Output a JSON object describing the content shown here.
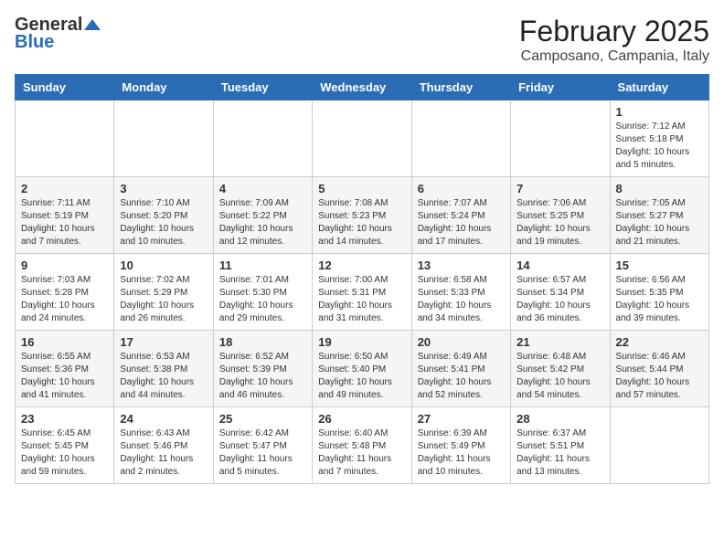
{
  "header": {
    "logo_general": "General",
    "logo_blue": "Blue",
    "month_title": "February 2025",
    "location": "Camposano, Campania, Italy"
  },
  "days_of_week": [
    "Sunday",
    "Monday",
    "Tuesday",
    "Wednesday",
    "Thursday",
    "Friday",
    "Saturday"
  ],
  "weeks": [
    [
      {
        "day": "",
        "info": ""
      },
      {
        "day": "",
        "info": ""
      },
      {
        "day": "",
        "info": ""
      },
      {
        "day": "",
        "info": ""
      },
      {
        "day": "",
        "info": ""
      },
      {
        "day": "",
        "info": ""
      },
      {
        "day": "1",
        "info": "Sunrise: 7:12 AM\nSunset: 5:18 PM\nDaylight: 10 hours and 5 minutes."
      }
    ],
    [
      {
        "day": "2",
        "info": "Sunrise: 7:11 AM\nSunset: 5:19 PM\nDaylight: 10 hours and 7 minutes."
      },
      {
        "day": "3",
        "info": "Sunrise: 7:10 AM\nSunset: 5:20 PM\nDaylight: 10 hours and 10 minutes."
      },
      {
        "day": "4",
        "info": "Sunrise: 7:09 AM\nSunset: 5:22 PM\nDaylight: 10 hours and 12 minutes."
      },
      {
        "day": "5",
        "info": "Sunrise: 7:08 AM\nSunset: 5:23 PM\nDaylight: 10 hours and 14 minutes."
      },
      {
        "day": "6",
        "info": "Sunrise: 7:07 AM\nSunset: 5:24 PM\nDaylight: 10 hours and 17 minutes."
      },
      {
        "day": "7",
        "info": "Sunrise: 7:06 AM\nSunset: 5:25 PM\nDaylight: 10 hours and 19 minutes."
      },
      {
        "day": "8",
        "info": "Sunrise: 7:05 AM\nSunset: 5:27 PM\nDaylight: 10 hours and 21 minutes."
      }
    ],
    [
      {
        "day": "9",
        "info": "Sunrise: 7:03 AM\nSunset: 5:28 PM\nDaylight: 10 hours and 24 minutes."
      },
      {
        "day": "10",
        "info": "Sunrise: 7:02 AM\nSunset: 5:29 PM\nDaylight: 10 hours and 26 minutes."
      },
      {
        "day": "11",
        "info": "Sunrise: 7:01 AM\nSunset: 5:30 PM\nDaylight: 10 hours and 29 minutes."
      },
      {
        "day": "12",
        "info": "Sunrise: 7:00 AM\nSunset: 5:31 PM\nDaylight: 10 hours and 31 minutes."
      },
      {
        "day": "13",
        "info": "Sunrise: 6:58 AM\nSunset: 5:33 PM\nDaylight: 10 hours and 34 minutes."
      },
      {
        "day": "14",
        "info": "Sunrise: 6:57 AM\nSunset: 5:34 PM\nDaylight: 10 hours and 36 minutes."
      },
      {
        "day": "15",
        "info": "Sunrise: 6:56 AM\nSunset: 5:35 PM\nDaylight: 10 hours and 39 minutes."
      }
    ],
    [
      {
        "day": "16",
        "info": "Sunrise: 6:55 AM\nSunset: 5:36 PM\nDaylight: 10 hours and 41 minutes."
      },
      {
        "day": "17",
        "info": "Sunrise: 6:53 AM\nSunset: 5:38 PM\nDaylight: 10 hours and 44 minutes."
      },
      {
        "day": "18",
        "info": "Sunrise: 6:52 AM\nSunset: 5:39 PM\nDaylight: 10 hours and 46 minutes."
      },
      {
        "day": "19",
        "info": "Sunrise: 6:50 AM\nSunset: 5:40 PM\nDaylight: 10 hours and 49 minutes."
      },
      {
        "day": "20",
        "info": "Sunrise: 6:49 AM\nSunset: 5:41 PM\nDaylight: 10 hours and 52 minutes."
      },
      {
        "day": "21",
        "info": "Sunrise: 6:48 AM\nSunset: 5:42 PM\nDaylight: 10 hours and 54 minutes."
      },
      {
        "day": "22",
        "info": "Sunrise: 6:46 AM\nSunset: 5:44 PM\nDaylight: 10 hours and 57 minutes."
      }
    ],
    [
      {
        "day": "23",
        "info": "Sunrise: 6:45 AM\nSunset: 5:45 PM\nDaylight: 10 hours and 59 minutes."
      },
      {
        "day": "24",
        "info": "Sunrise: 6:43 AM\nSunset: 5:46 PM\nDaylight: 11 hours and 2 minutes."
      },
      {
        "day": "25",
        "info": "Sunrise: 6:42 AM\nSunset: 5:47 PM\nDaylight: 11 hours and 5 minutes."
      },
      {
        "day": "26",
        "info": "Sunrise: 6:40 AM\nSunset: 5:48 PM\nDaylight: 11 hours and 7 minutes."
      },
      {
        "day": "27",
        "info": "Sunrise: 6:39 AM\nSunset: 5:49 PM\nDaylight: 11 hours and 10 minutes."
      },
      {
        "day": "28",
        "info": "Sunrise: 6:37 AM\nSunset: 5:51 PM\nDaylight: 11 hours and 13 minutes."
      },
      {
        "day": "",
        "info": ""
      }
    ]
  ]
}
